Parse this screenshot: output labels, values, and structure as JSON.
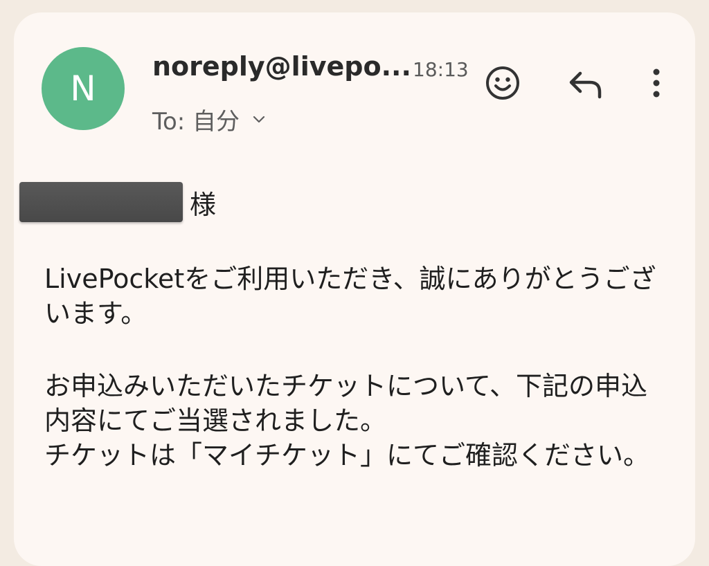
{
  "email": {
    "avatar_letter": "N",
    "avatar_color": "#5cb98a",
    "sender": "noreply@livepo...",
    "time": "18:13",
    "to_label": "To: 自分",
    "icons": [
      "emoji-icon",
      "reply-icon",
      "more-vert-icon",
      "chevron-down-icon"
    ]
  },
  "body": {
    "honorific": "様",
    "para1": "LivePocketをご利用いただき、誠にありがとうございます。",
    "para2_line1": "お申込みいただいたチケットについて、下記の申込内容にてご当選されました。",
    "para2_line2": "チケットは「マイチケット」にてご確認ください。"
  }
}
